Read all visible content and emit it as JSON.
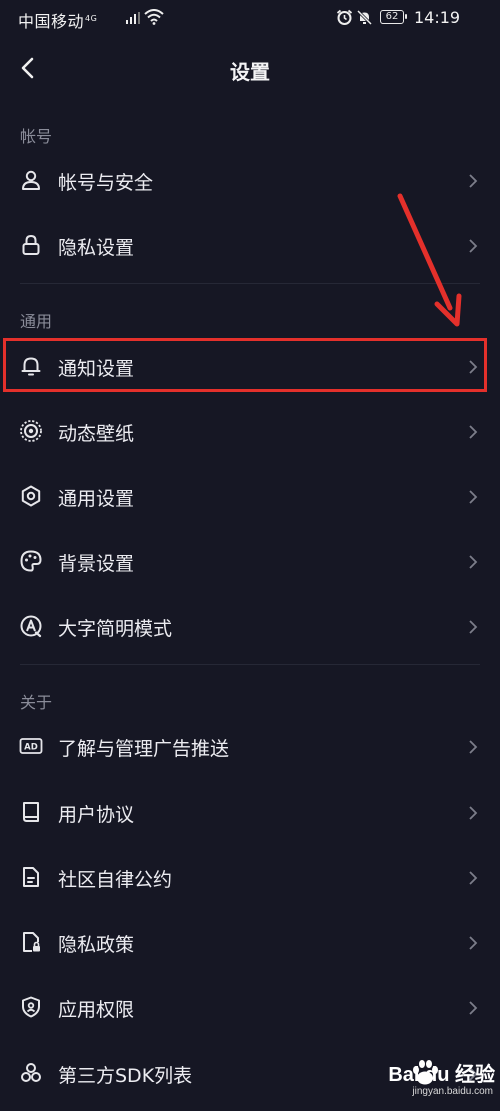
{
  "status_bar": {
    "carrier": "中国移动",
    "network": "4G",
    "battery": "62",
    "time": "14:19"
  },
  "nav": {
    "title": "设置",
    "back_icon": "chevron-left-icon"
  },
  "sections": [
    {
      "header": "帐号",
      "items": [
        {
          "label": "帐号与安全",
          "icon": "user-icon"
        },
        {
          "label": "隐私设置",
          "icon": "lock-icon"
        }
      ]
    },
    {
      "header": "通用",
      "items": [
        {
          "label": "通知设置",
          "icon": "bell-icon",
          "highlighted": true
        },
        {
          "label": "动态壁纸",
          "icon": "live-wallpaper-icon"
        },
        {
          "label": "通用设置",
          "icon": "gear-icon"
        },
        {
          "label": "背景设置",
          "icon": "palette-icon"
        },
        {
          "label": "大字简明模式",
          "icon": "font-size-icon"
        }
      ]
    },
    {
      "header": "关于",
      "items": [
        {
          "label": "了解与管理广告推送",
          "icon": "ad-icon"
        },
        {
          "label": "用户协议",
          "icon": "book-icon"
        },
        {
          "label": "社区自律公约",
          "icon": "document-icon"
        },
        {
          "label": "隐私政策",
          "icon": "privacy-doc-icon"
        },
        {
          "label": "应用权限",
          "icon": "shield-icon"
        },
        {
          "label": "第三方SDK列表",
          "icon": "sdk-icon"
        }
      ]
    }
  ],
  "annotation": {
    "color": "#e4302b"
  },
  "watermark": {
    "brand": "Bai du 经验",
    "url": "jingyan.baidu.com"
  }
}
